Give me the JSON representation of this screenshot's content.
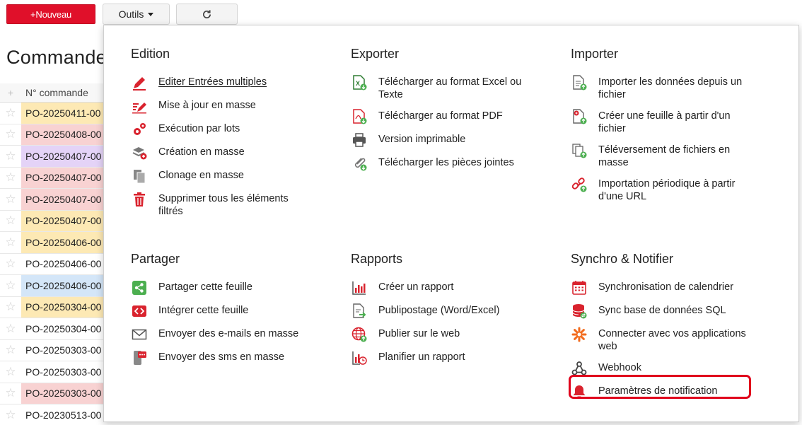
{
  "toolbar": {
    "new_label": "+Nouveau",
    "tools_label": "Outils"
  },
  "page": {
    "title": "Commandes"
  },
  "grid": {
    "column_header": "N° commande",
    "rows": [
      {
        "value": "PO-20250411-00",
        "color": "#fde9b4"
      },
      {
        "value": "PO-20250408-00",
        "color": "#f8d2d2"
      },
      {
        "value": "PO-20250407-00",
        "color": "#e4d3f7"
      },
      {
        "value": "PO-20250407-00",
        "color": "#f8d2d2"
      },
      {
        "value": "PO-20250407-00",
        "color": "#f8d2d2"
      },
      {
        "value": "PO-20250407-00",
        "color": "#fde9b4"
      },
      {
        "value": "PO-20250406-00",
        "color": "#fde9b4"
      },
      {
        "value": "PO-20250406-00",
        "color": "#ffffff"
      },
      {
        "value": "PO-20250406-00",
        "color": "#d4e6f8"
      },
      {
        "value": "PO-20250304-00",
        "color": "#fde9b4"
      },
      {
        "value": "PO-20250304-00",
        "color": "#ffffff"
      },
      {
        "value": "PO-20250303-00",
        "color": "#ffffff"
      },
      {
        "value": "PO-20250303-00",
        "color": "#ffffff"
      },
      {
        "value": "PO-20250303-00",
        "color": "#f8d2d2"
      },
      {
        "value": "PO-20230513-00",
        "color": "#ffffff"
      }
    ]
  },
  "menu": {
    "edition": {
      "title": "Edition",
      "items": [
        {
          "label": "Editer Entrées multiples",
          "icon": "edit-multiple-icon"
        },
        {
          "label": "Mise à jour en masse",
          "icon": "bulk-update-icon"
        },
        {
          "label": "Exécution par lots",
          "icon": "batch-gears-icon"
        },
        {
          "label": "Création en masse",
          "icon": "bulk-create-icon"
        },
        {
          "label": "Clonage en masse",
          "icon": "bulk-clone-icon"
        },
        {
          "label": "Supprimer tous les éléments filtrés",
          "icon": "trash-icon"
        }
      ]
    },
    "exporter": {
      "title": "Exporter",
      "items": [
        {
          "label": "Télécharger au format Excel ou Texte",
          "icon": "excel-download-icon"
        },
        {
          "label": "Télécharger au format PDF",
          "icon": "pdf-download-icon"
        },
        {
          "label": "Version imprimable",
          "icon": "printer-icon"
        },
        {
          "label": "Télécharger les pièces jointes",
          "icon": "attachment-download-icon"
        }
      ]
    },
    "importer": {
      "title": "Importer",
      "items": [
        {
          "label": "Importer les données depuis un fichier",
          "icon": "file-import-icon"
        },
        {
          "label": "Créer une feuille à partir d'un fichier",
          "icon": "sheet-from-file-icon"
        },
        {
          "label": "Téléversement de fichiers en masse",
          "icon": "bulk-upload-icon"
        },
        {
          "label": "Importation périodique à partir d'une URL",
          "icon": "url-import-icon"
        }
      ]
    },
    "partager": {
      "title": "Partager",
      "items": [
        {
          "label": "Partager cette feuille",
          "icon": "share-icon"
        },
        {
          "label": "Intégrer cette feuille",
          "icon": "embed-icon"
        },
        {
          "label": "Envoyer des e-mails en masse",
          "icon": "envelope-icon"
        },
        {
          "label": "Envoyer des sms en masse",
          "icon": "sms-icon"
        }
      ]
    },
    "rapports": {
      "title": "Rapports",
      "items": [
        {
          "label": "Créer un rapport",
          "icon": "report-chart-icon"
        },
        {
          "label": "Publipostage (Word/Excel)",
          "icon": "mail-merge-icon"
        },
        {
          "label": "Publier sur le web",
          "icon": "globe-icon"
        },
        {
          "label": "Planifier un rapport",
          "icon": "scheduled-report-icon"
        }
      ]
    },
    "synchro": {
      "title": "Synchro & Notifier",
      "items": [
        {
          "label": "Synchronisation de calendrier",
          "icon": "calendar-icon"
        },
        {
          "label": "Sync base de données SQL",
          "icon": "database-icon"
        },
        {
          "label": "Connecter avec vos applications web",
          "icon": "zapier-icon"
        },
        {
          "label": "Webhook",
          "icon": "webhook-icon"
        },
        {
          "label": "Paramètres de notification",
          "icon": "bell-icon"
        }
      ]
    }
  },
  "colors": {
    "accent_red": "#e0102a",
    "green": "#4caf50",
    "highlight_red": "#e0001b"
  }
}
